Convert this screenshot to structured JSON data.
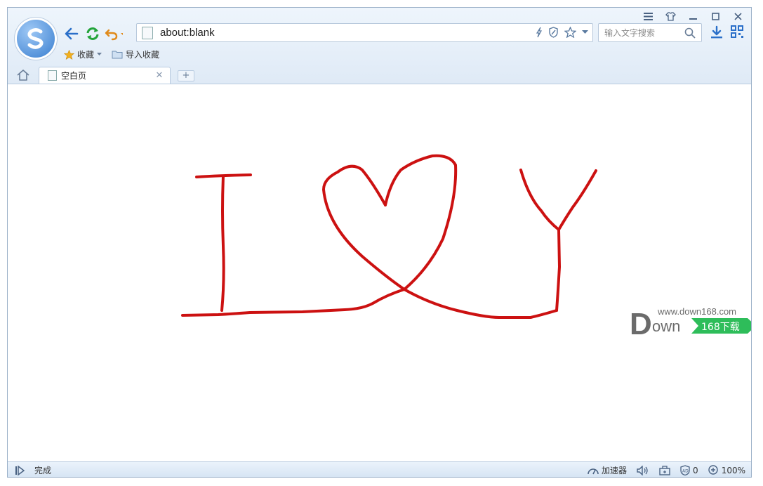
{
  "window": {
    "controls": [
      "menu-icon",
      "skin-icon",
      "minimize-icon",
      "maximize-icon",
      "close-icon"
    ]
  },
  "address": {
    "value": "about:blank"
  },
  "search": {
    "placeholder": "输入文字搜索"
  },
  "bookmarks": {
    "favorites_label": "收藏",
    "import_label": "导入收藏"
  },
  "tabs": [
    {
      "label": "空白页",
      "active": true
    }
  ],
  "drawing": {
    "stroke_color": "#cc1111",
    "letters": [
      "I",
      "heart",
      "Y"
    ]
  },
  "watermark": {
    "site": "www.down168.com",
    "brand_D": "D",
    "brand_rest": "own",
    "badge": "168下载",
    "badge_color": "#2ebd5a"
  },
  "status": {
    "text": "完成",
    "accelerator": "加速器",
    "adblock_count": "0",
    "zoom": "100%"
  },
  "colors": {
    "nav_back": "#2a6fc9",
    "nav_refresh": "#23a43a",
    "nav_undo": "#e08a1a"
  }
}
